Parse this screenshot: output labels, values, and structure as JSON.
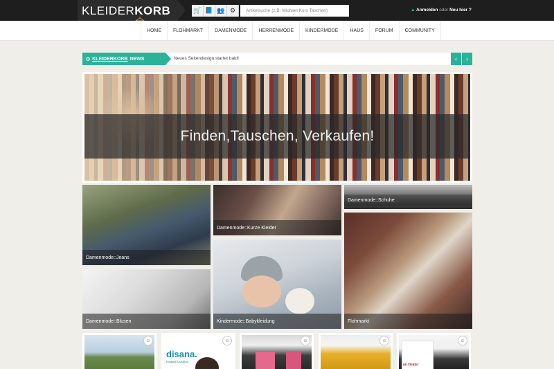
{
  "logo": {
    "light": "KLEIDER",
    "bold": "KORB"
  },
  "topbar": {
    "icons": [
      "cart-icon",
      "book-icon",
      "users-icon",
      "settings-icon"
    ],
    "icon_glyphs": [
      "🛒",
      "📘",
      "👥",
      "⚙"
    ],
    "search_placeholder": "Artikelsuche (z.B. Michael Kors Taschen)",
    "login_label": "Anmelden",
    "or_label": "oder",
    "register_label": "Neu hier ?"
  },
  "nav": {
    "items": [
      "HOME",
      "FLOHMARKT",
      "DAMENMODE",
      "HERRENMODE",
      "KINDERMODE",
      "HAUS",
      "FORUM",
      "COMMUNITY"
    ]
  },
  "news": {
    "label_brand": "KLEIDERKORB",
    "label_suffix": "NEWS",
    "text": "Neues Seitendesign startet bald!",
    "prev_glyph": "‹",
    "next_glyph": "›"
  },
  "hero": {
    "title": "Finden,Tauschen, Verkaufen!"
  },
  "tiles": {
    "jeans": "Damenmode::Jeans",
    "kleider": "Damenmode::Kurze Kleider",
    "schuhe": "Damenmode::Schuhe",
    "blusen": "Damenmode::Blusen",
    "baby": "Kindermode::Babykleidung",
    "flohmarkt": "Flohmarkt"
  },
  "products": {
    "brand_text": "disana.",
    "tagline": "Heated Cushion",
    "heater_text": "an Heater",
    "badge_glyph": "☺"
  },
  "colors": {
    "accent": "#2bb39a",
    "topbar": "#1e1e1e",
    "background": "#efeee9"
  }
}
